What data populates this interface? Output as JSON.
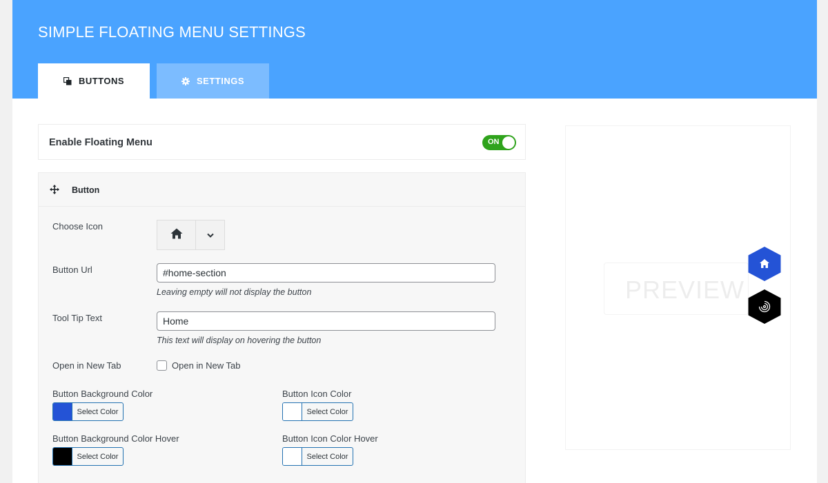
{
  "header": {
    "title": "SIMPLE FLOATING MENU SETTINGS",
    "bg_color": "#4aa3ff"
  },
  "tabs": [
    {
      "label": "BUTTONS",
      "icon": "copy-icon",
      "active": true
    },
    {
      "label": "SETTINGS",
      "icon": "gear-icon",
      "active": false
    }
  ],
  "enable": {
    "label": "Enable Floating Menu",
    "toggle_text": "ON",
    "toggle_color": "#2fa31c"
  },
  "button_panel": {
    "title": "Button",
    "choose_icon_label": "Choose Icon",
    "selected_icon": "home-icon",
    "url_label": "Button Url",
    "url_value": "#home-section",
    "url_help": "Leaving empty will not display the button",
    "tooltip_label": "Tool Tip Text",
    "tooltip_value": "Home",
    "tooltip_help": "This text will display on hovering the button",
    "new_tab_label": "Open in New Tab",
    "new_tab_checkbox_label": "Open in New Tab",
    "new_tab_checked": false,
    "colors": {
      "bg_label": "Button Background Color",
      "bg_value": "#2453d6",
      "icon_label": "Button Icon Color",
      "icon_value": "#ffffff",
      "bg_hover_label": "Button Background Color Hover",
      "bg_hover_value": "#000000",
      "icon_hover_label": "Button Icon Color Hover",
      "icon_hover_value": "#ffffff",
      "select_label": "Select Color"
    }
  },
  "preview": {
    "text": "PREVIEW",
    "buttons": [
      {
        "icon": "home-icon",
        "color": "#2453d6"
      },
      {
        "icon": "spiral-icon",
        "color": "#000000"
      }
    ]
  }
}
